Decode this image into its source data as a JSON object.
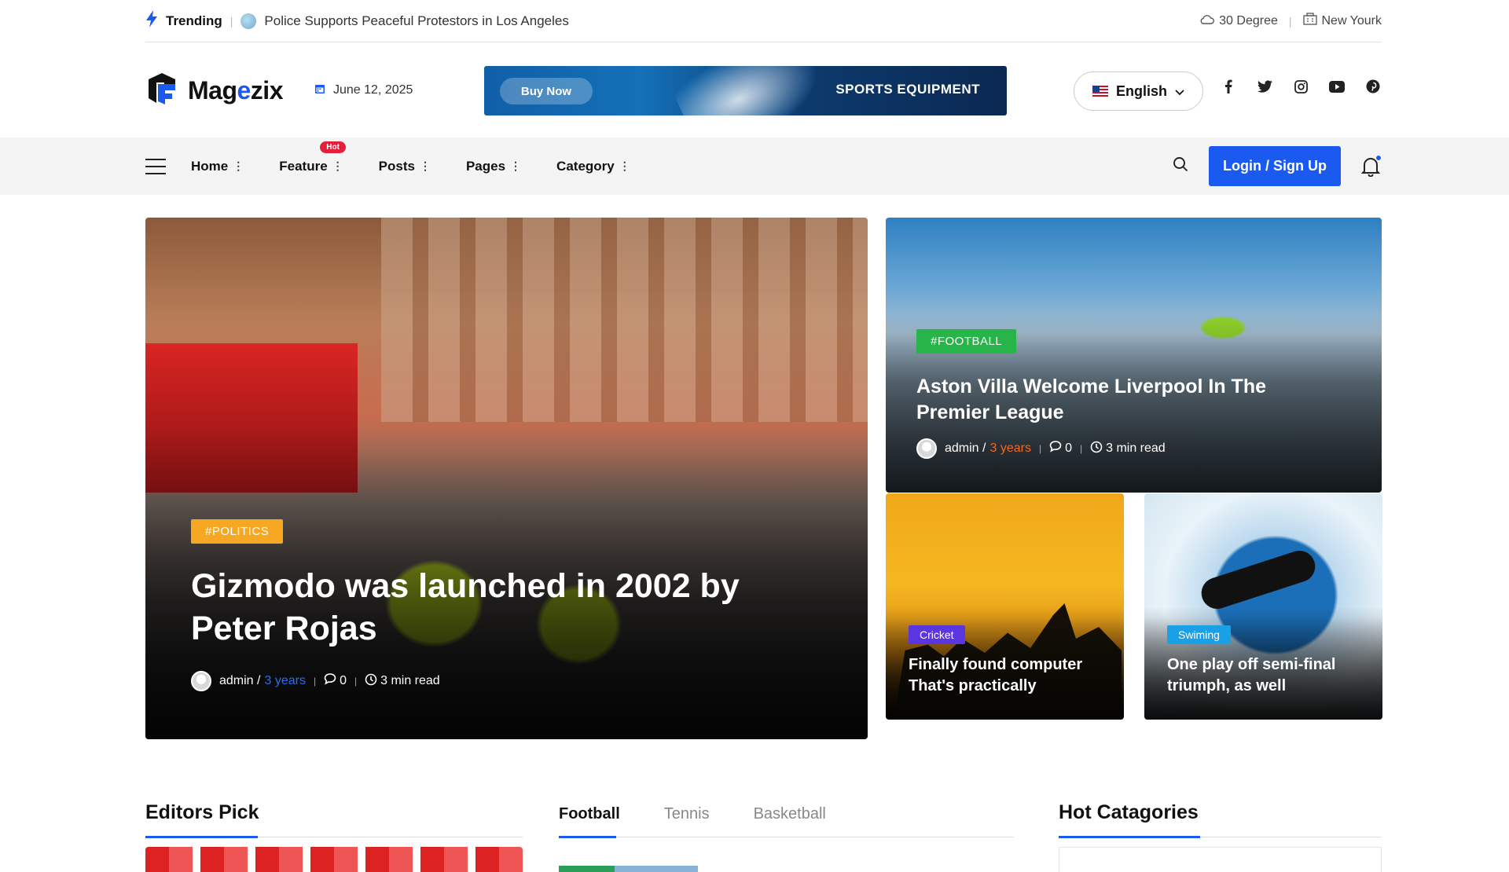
{
  "topbar": {
    "trending_label": "Trending",
    "trending_headline": "Police Supports Peaceful Protestors in Los Angeles",
    "weather": "30 Degree",
    "city": "New Yourk"
  },
  "header": {
    "logo_pre": "Mag",
    "logo_accent": "e",
    "logo_post": "zix",
    "date": "June 12, 2025",
    "banner_button": "Buy Now",
    "banner_text": "SPORTS EQUIPMENT",
    "language": "English",
    "socials": [
      "facebook-icon",
      "twitter-icon",
      "instagram-icon",
      "youtube-icon",
      "pinterest-icon"
    ]
  },
  "nav": {
    "items": [
      {
        "label": "Home"
      },
      {
        "label": "Feature",
        "badge": "Hot"
      },
      {
        "label": "Posts"
      },
      {
        "label": "Pages"
      },
      {
        "label": "Category"
      }
    ],
    "login_label": "Login / Sign Up"
  },
  "hero": {
    "main": {
      "tag": "#POLITICS",
      "title": "Gizmodo was launched in 2002 by Peter Rojas",
      "author": "admin /",
      "time_ago": "3 years",
      "comments": "0",
      "read_time": "3 min read"
    },
    "top": {
      "tag": "#FOOTBALL",
      "title": "Aston Villa Welcome Liverpool In The Premier League",
      "author": "admin /",
      "time_ago": "3 years",
      "comments": "0",
      "read_time": "3 min read"
    },
    "small": [
      {
        "tag": "Cricket",
        "title": "Finally found computer That's practically"
      },
      {
        "tag": "Swiming",
        "title": "One play off semi-final triumph, as well"
      }
    ]
  },
  "sections": {
    "editors_pick": "Editors Pick",
    "tabs": [
      "Football",
      "Tennis",
      "Basketball"
    ],
    "hot_categories": "Hot Catagories"
  },
  "colors": {
    "accent": "#1b5af0",
    "politics": "#f7a823",
    "football": "#27b54a",
    "cricket": "#5b35e0",
    "swiming": "#1aa0e6",
    "hot_badge": "#e51f3b",
    "time_ago_main": "#2b6cf2",
    "time_ago_top": "#f26a1b"
  }
}
